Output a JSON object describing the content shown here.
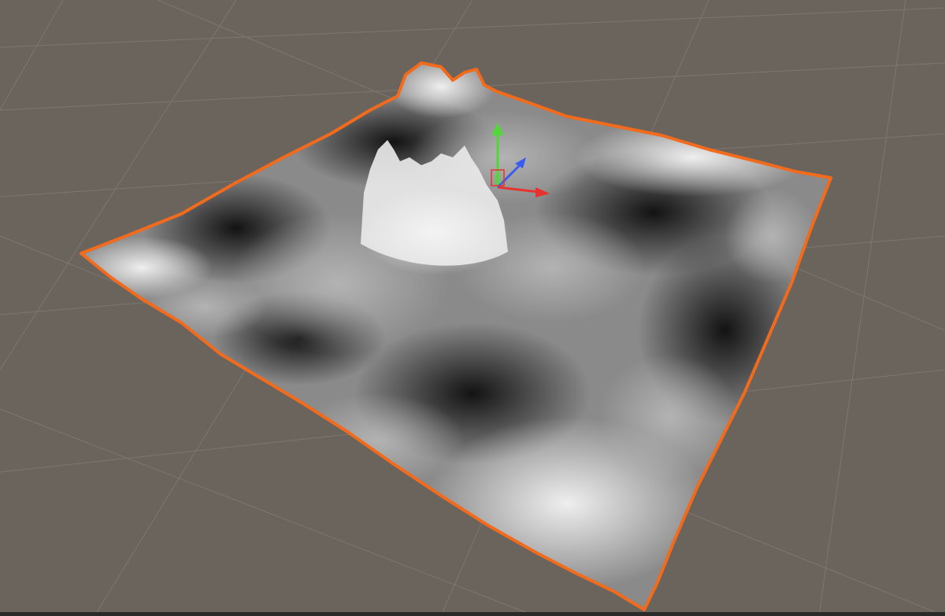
{
  "scene": {
    "background_color": "#6b645d",
    "grid_color": "#7c7770",
    "selection_outline_color": "#f26b1d",
    "terrain_light_color": "#f4f4f4",
    "terrain_dark_color": "#121212",
    "selected_object": "terrain-mesh",
    "grid_visible": true
  },
  "gizmo": {
    "tool": "move",
    "axis_colors": {
      "x": "#e8322d",
      "y": "#52d63a",
      "z": "#3a5cf0"
    },
    "icons": [
      "move-gizmo-icon"
    ]
  }
}
